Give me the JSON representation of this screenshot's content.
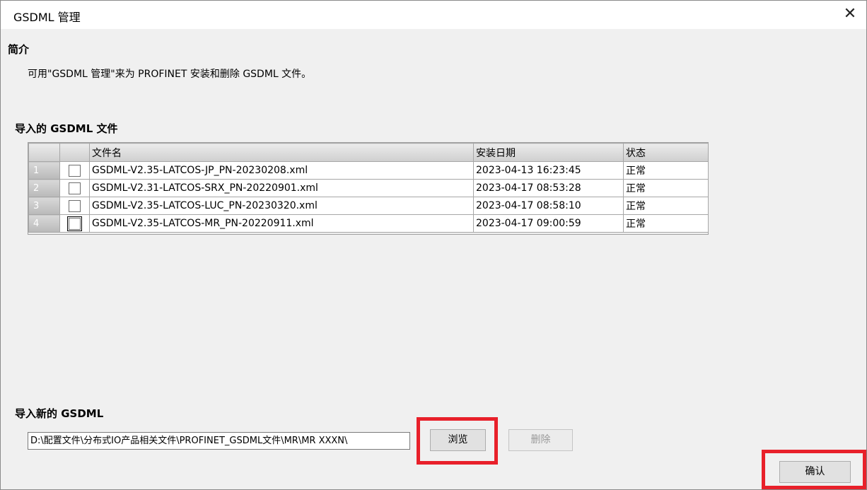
{
  "window": {
    "title": "GSDML 管理",
    "close_glyph": "✕"
  },
  "intro": {
    "heading": "简介",
    "text": "可用\"GSDML 管理\"来为 PROFINET 安装和删除 GSDML 文件。"
  },
  "imported": {
    "heading": "导入的 GSDML 文件",
    "columns": [
      "文件名",
      "安装日期",
      "状态"
    ],
    "rows": [
      {
        "num": "1",
        "file": "GSDML-V2.35-LATCOS-JP_PN-20230208.xml",
        "date": "2023-04-13 16:23:45",
        "status": "正常"
      },
      {
        "num": "2",
        "file": "GSDML-V2.31-LATCOS-SRX_PN-20220901.xml",
        "date": "2023-04-17 08:53:28",
        "status": "正常"
      },
      {
        "num": "3",
        "file": "GSDML-V2.35-LATCOS-LUC_PN-20230320.xml",
        "date": "2023-04-17 08:58:10",
        "status": "正常"
      },
      {
        "num": "4",
        "file": "GSDML-V2.35-LATCOS-MR_PN-20220911.xml",
        "date": "2023-04-17 09:00:59",
        "status": "正常"
      }
    ]
  },
  "import_new": {
    "heading": "导入新的 GSDML",
    "path_value": "D:\\配置文件\\分布式IO产品相关文件\\PROFINET_GSDML文件\\MR\\MR XXXN\\",
    "browse_label": "浏览",
    "delete_label": "删除"
  },
  "confirm_label": "确认",
  "colors": {
    "highlight": "#e8202a"
  }
}
